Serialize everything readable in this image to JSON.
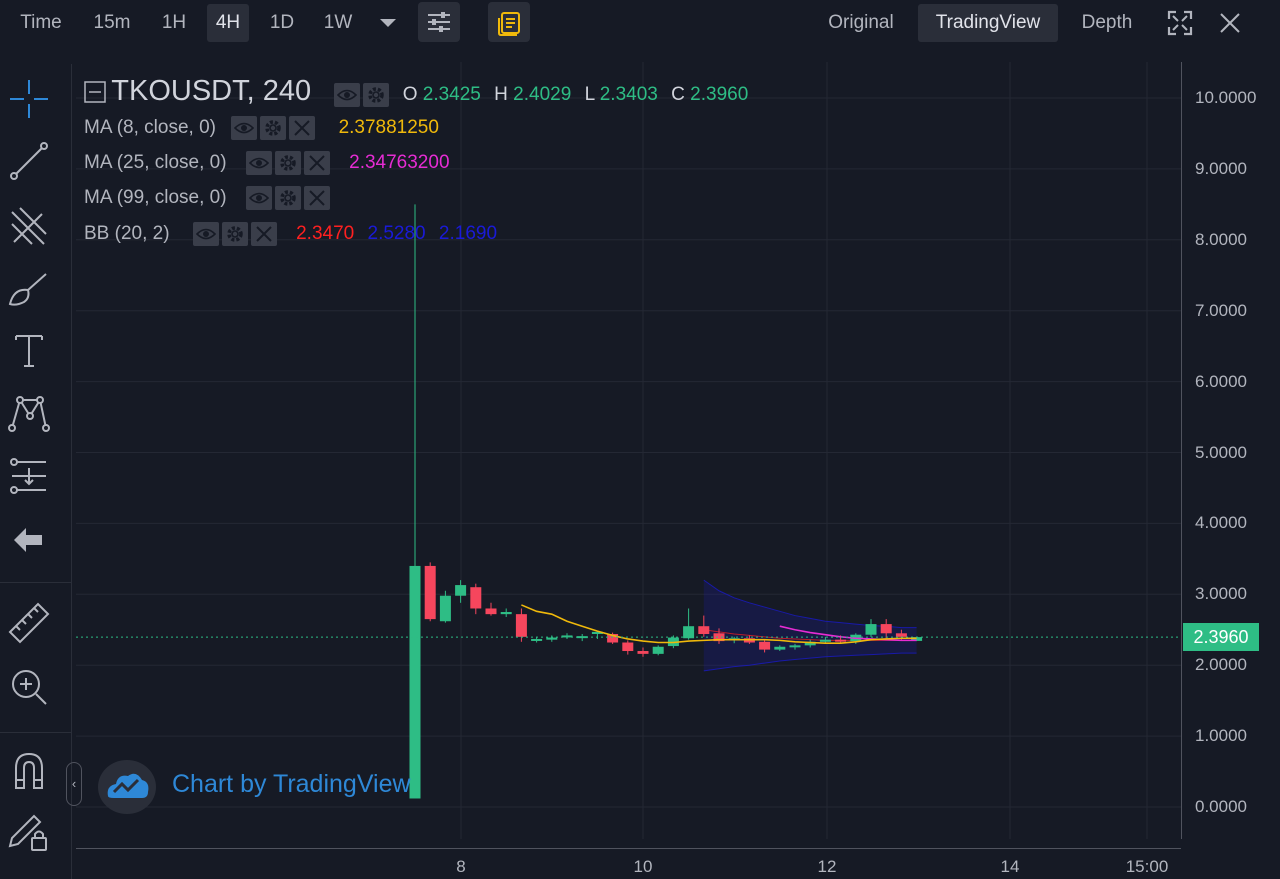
{
  "toolbar": {
    "intervals": [
      "Time",
      "15m",
      "1H",
      "4H",
      "1D",
      "1W"
    ],
    "active_interval": "4H",
    "views": [
      "Original",
      "TradingView",
      "Depth"
    ],
    "active_view": "TradingView"
  },
  "legend": {
    "symbol": "TKOUSDT, 240",
    "ohlc": {
      "o_label": "O",
      "o": "2.3425",
      "h_label": "H",
      "h": "2.4029",
      "l_label": "L",
      "l": "2.3403",
      "c_label": "C",
      "c": "2.3960"
    },
    "ma8": {
      "label": "MA (8, close, 0)",
      "value": "2.37881250",
      "color": "#f0b90b"
    },
    "ma25": {
      "label": "MA (25, close, 0)",
      "value": "2.34763200",
      "color": "#e62cd4"
    },
    "ma99": {
      "label": "MA (99, close, 0)"
    },
    "bb": {
      "label": "BB (20, 2)",
      "basis": "2.3470",
      "upper": "2.5280",
      "lower": "2.1690",
      "basis_color": "#ff2020",
      "band_color": "#1a1ad8"
    }
  },
  "watermark": "Chart by TradingView",
  "price_tag": "2.3960",
  "colors": {
    "up": "#2ebd85",
    "down": "#f6465d",
    "bg": "#161a25",
    "grid": "#242834"
  },
  "chart_data": {
    "type": "candlestick",
    "ylim": [
      0,
      10
    ],
    "y_ticks": [
      "10.0000",
      "9.0000",
      "8.0000",
      "7.0000",
      "6.0000",
      "5.0000",
      "4.0000",
      "3.0000",
      "2.0000",
      "1.0000",
      "0.0000"
    ],
    "x_ticks": [
      "8",
      "10",
      "12",
      "14",
      "15:00"
    ],
    "last_price": 2.396,
    "candles": [
      {
        "o": 0.12,
        "h": 8.5,
        "l": 0.12,
        "c": 3.4
      },
      {
        "o": 3.4,
        "h": 3.45,
        "l": 2.62,
        "c": 2.65
      },
      {
        "o": 2.62,
        "h": 3.05,
        "l": 2.6,
        "c": 2.98
      },
      {
        "o": 2.98,
        "h": 3.2,
        "l": 2.88,
        "c": 3.13
      },
      {
        "o": 3.1,
        "h": 3.15,
        "l": 2.72,
        "c": 2.8
      },
      {
        "o": 2.8,
        "h": 2.88,
        "l": 2.7,
        "c": 2.72
      },
      {
        "o": 2.72,
        "h": 2.8,
        "l": 2.68,
        "c": 2.75
      },
      {
        "o": 2.72,
        "h": 2.8,
        "l": 2.33,
        "c": 2.4
      },
      {
        "o": 2.35,
        "h": 2.4,
        "l": 2.32,
        "c": 2.37
      },
      {
        "o": 2.36,
        "h": 2.42,
        "l": 2.33,
        "c": 2.39
      },
      {
        "o": 2.4,
        "h": 2.45,
        "l": 2.37,
        "c": 2.42
      },
      {
        "o": 2.39,
        "h": 2.44,
        "l": 2.34,
        "c": 2.41
      },
      {
        "o": 2.44,
        "h": 2.48,
        "l": 2.37,
        "c": 2.47
      },
      {
        "o": 2.44,
        "h": 2.46,
        "l": 2.3,
        "c": 2.32
      },
      {
        "o": 2.32,
        "h": 2.35,
        "l": 2.15,
        "c": 2.2
      },
      {
        "o": 2.2,
        "h": 2.25,
        "l": 2.12,
        "c": 2.16
      },
      {
        "o": 2.16,
        "h": 2.28,
        "l": 2.14,
        "c": 2.26
      },
      {
        "o": 2.27,
        "h": 2.42,
        "l": 2.24,
        "c": 2.39
      },
      {
        "o": 2.38,
        "h": 2.8,
        "l": 2.36,
        "c": 2.55
      },
      {
        "o": 2.55,
        "h": 2.7,
        "l": 2.4,
        "c": 2.44
      },
      {
        "o": 2.45,
        "h": 2.52,
        "l": 2.3,
        "c": 2.34
      },
      {
        "o": 2.35,
        "h": 2.4,
        "l": 2.31,
        "c": 2.38
      },
      {
        "o": 2.38,
        "h": 2.42,
        "l": 2.3,
        "c": 2.32
      },
      {
        "o": 2.33,
        "h": 2.36,
        "l": 2.18,
        "c": 2.22
      },
      {
        "o": 2.22,
        "h": 2.28,
        "l": 2.2,
        "c": 2.26
      },
      {
        "o": 2.26,
        "h": 2.3,
        "l": 2.22,
        "c": 2.28
      },
      {
        "o": 2.28,
        "h": 2.36,
        "l": 2.25,
        "c": 2.33
      },
      {
        "o": 2.33,
        "h": 2.4,
        "l": 2.3,
        "c": 2.36
      },
      {
        "o": 2.36,
        "h": 2.42,
        "l": 2.32,
        "c": 2.34
      },
      {
        "o": 2.34,
        "h": 2.45,
        "l": 2.3,
        "c": 2.43
      },
      {
        "o": 2.43,
        "h": 2.65,
        "l": 2.4,
        "c": 2.58
      },
      {
        "o": 2.58,
        "h": 2.65,
        "l": 2.38,
        "c": 2.45
      },
      {
        "o": 2.45,
        "h": 2.5,
        "l": 2.36,
        "c": 2.4
      },
      {
        "o": 2.3425,
        "h": 2.4029,
        "l": 2.3403,
        "c": 2.396
      }
    ],
    "ma8": [
      null,
      null,
      null,
      null,
      null,
      null,
      null,
      2.85,
      2.76,
      2.72,
      2.62,
      2.55,
      2.48,
      2.42,
      2.37,
      2.34,
      2.32,
      2.32,
      2.34,
      2.35,
      2.36,
      2.36,
      2.36,
      2.36,
      2.35,
      2.33,
      2.32,
      2.31,
      2.31,
      2.33,
      2.36,
      2.37,
      2.38,
      2.38
    ],
    "ma25": [
      null,
      null,
      null,
      null,
      null,
      null,
      null,
      null,
      null,
      null,
      null,
      null,
      null,
      null,
      null,
      null,
      null,
      null,
      null,
      null,
      null,
      null,
      null,
      null,
      2.55,
      2.5,
      2.46,
      2.43,
      2.4,
      2.38,
      2.37,
      2.36,
      2.35,
      2.35
    ],
    "bb_upper": [
      null,
      null,
      null,
      null,
      null,
      null,
      null,
      null,
      null,
      null,
      null,
      null,
      null,
      null,
      null,
      null,
      null,
      null,
      null,
      3.2,
      3.05,
      2.95,
      2.88,
      2.82,
      2.76,
      2.7,
      2.66,
      2.62,
      2.6,
      2.58,
      2.56,
      2.55,
      2.53,
      2.53
    ],
    "bb_basis": [
      null,
      null,
      null,
      null,
      null,
      null,
      null,
      null,
      null,
      null,
      null,
      null,
      null,
      null,
      null,
      null,
      null,
      null,
      null,
      2.5,
      2.47,
      2.44,
      2.42,
      2.4,
      2.38,
      2.37,
      2.36,
      2.35,
      2.35,
      2.35,
      2.35,
      2.35,
      2.35,
      2.35
    ],
    "bb_lower": [
      null,
      null,
      null,
      null,
      null,
      null,
      null,
      null,
      null,
      null,
      null,
      null,
      null,
      null,
      null,
      null,
      null,
      null,
      null,
      1.92,
      1.95,
      1.98,
      2.0,
      2.03,
      2.06,
      2.08,
      2.1,
      2.12,
      2.13,
      2.14,
      2.15,
      2.16,
      2.17,
      2.17
    ]
  }
}
